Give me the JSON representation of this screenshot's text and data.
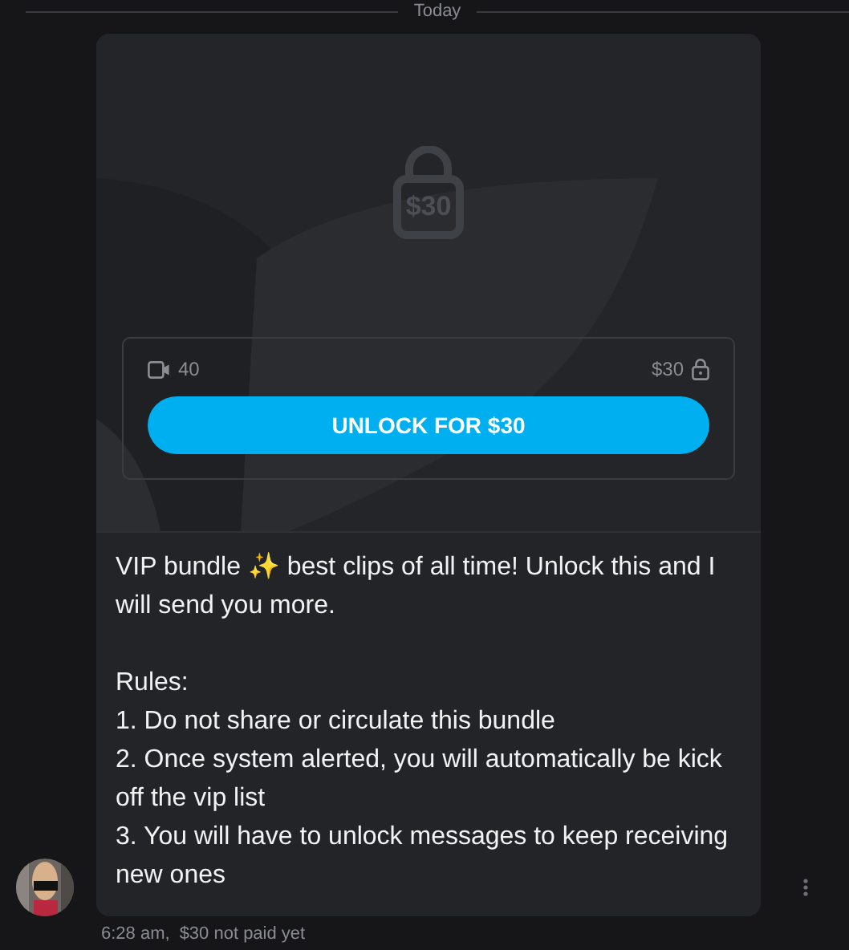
{
  "date_divider": "Today",
  "locked_media": {
    "price_badge": "$30",
    "video_count": "40",
    "price": "$30",
    "unlock_button": "UNLOCK FOR $30"
  },
  "message": {
    "text": "VIP bundle ✨ best clips of all time! Unlock this and I will send you more.\n\nRules:\n1. Do not share or circulate this bundle\n2. Once system alerted, you will automatically be kick off the vip list\n3. You will have to unlock messages to keep receiving new ones"
  },
  "footer": {
    "time": "6:28 am,",
    "payment_status": "$30 not paid yet"
  }
}
